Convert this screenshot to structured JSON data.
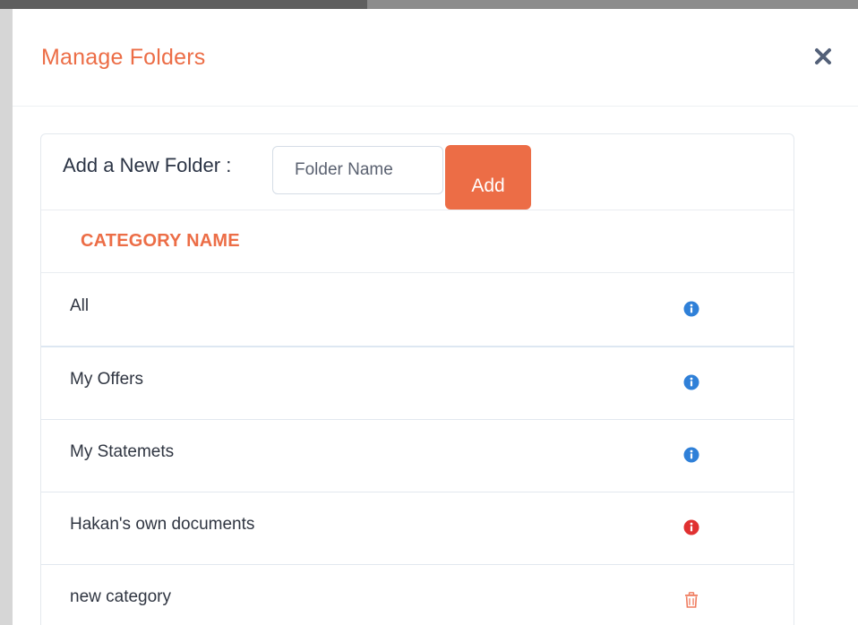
{
  "modal": {
    "title": "Manage Folders",
    "close_icon": "close-icon"
  },
  "add_folder": {
    "label": "Add a New Folder :",
    "input_placeholder": "Folder Name",
    "input_value": "",
    "button_label": "Add"
  },
  "table": {
    "column_header": "CATEGORY NAME",
    "rows": [
      {
        "name": "All",
        "icon": "info-icon",
        "icon_color": "#2f80d8"
      },
      {
        "name": "My Offers",
        "icon": "info-icon",
        "icon_color": "#2f80d8"
      },
      {
        "name": "My Statemets",
        "icon": "info-icon",
        "icon_color": "#2f80d8"
      },
      {
        "name": "Hakan's own documents",
        "icon": "info-icon",
        "icon_color": "#e03131"
      },
      {
        "name": "new category",
        "icon": "trash-icon",
        "icon_color": "#ef7c5f"
      }
    ]
  },
  "colors": {
    "accent": "#ec6d46",
    "info_blue": "#2f80d8",
    "info_red": "#e03131",
    "close_icon": "#536078"
  }
}
